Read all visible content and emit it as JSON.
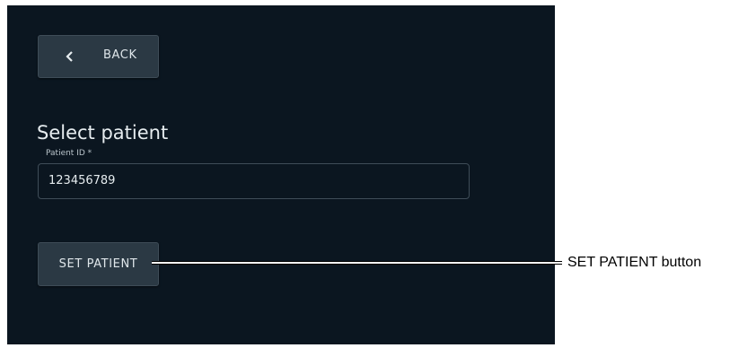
{
  "back_button": {
    "label": "BACK",
    "icon": "chevron-left-icon"
  },
  "page": {
    "title": "Select patient"
  },
  "patient_field": {
    "label": "Patient ID *",
    "value": "123456789"
  },
  "set_patient_button": {
    "label": "SET PATIENT"
  },
  "annotation": {
    "text": "SET PATIENT button"
  },
  "colors": {
    "background": "#0b1620",
    "button": "#2b3944",
    "text": "#e6ecef"
  }
}
